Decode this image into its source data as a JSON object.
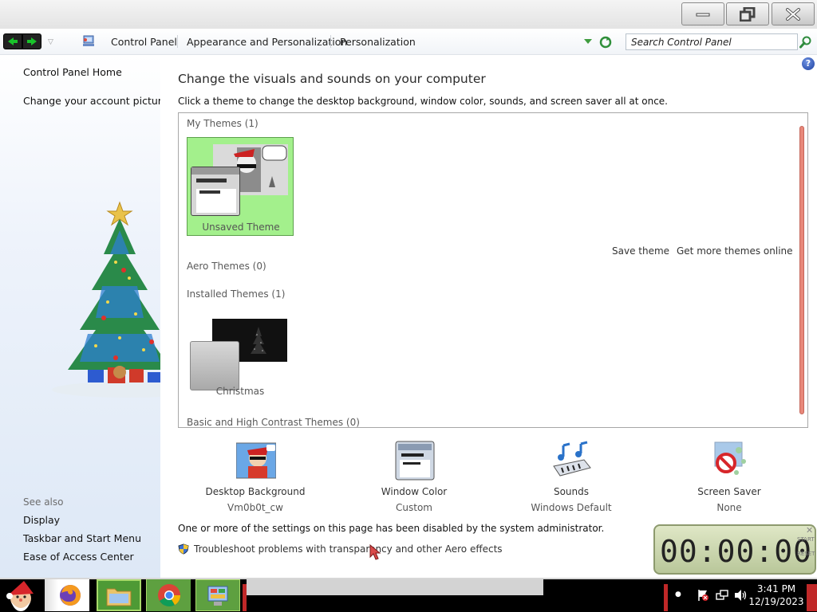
{
  "window": {
    "minimize_label": "Minimize",
    "maximize_label": "Restore",
    "close_label": "Close"
  },
  "addressbar": {
    "breadcrumbs": [
      "Control Panel",
      "Appearance and Personalization",
      "Personalization"
    ],
    "search_placeholder": "Search Control Panel"
  },
  "sidebar": {
    "links": [
      {
        "label": "Control Panel Home"
      },
      {
        "label": "Change your account picture"
      }
    ],
    "see_also_label": "See also",
    "see_also": [
      {
        "label": "Display"
      },
      {
        "label": "Taskbar and Start Menu"
      },
      {
        "label": "Ease of Access Center"
      }
    ]
  },
  "main": {
    "title": "Change the visuals and sounds on your computer",
    "subtitle": "Click a theme to change the desktop background, window color, sounds, and screen saver all at once.",
    "groups": {
      "my_themes": "My Themes (1)",
      "aero_themes": "Aero Themes (0)",
      "installed_themes": "Installed Themes (1)",
      "basic_themes": "Basic and High Contrast Themes (0)"
    },
    "themes": [
      {
        "label": "Unsaved Theme",
        "selected": true
      },
      {
        "label": "Christmas",
        "selected": false
      }
    ],
    "save_theme": "Save theme",
    "get_more_themes": "Get more themes online",
    "settings": [
      {
        "name": "Desktop Background",
        "value": "Vm0b0t_cw",
        "icon": "desktop-background-icon"
      },
      {
        "name": "Window Color",
        "value": "Custom",
        "icon": "window-color-icon"
      },
      {
        "name": "Sounds",
        "value": "Windows Default",
        "icon": "sounds-icon"
      },
      {
        "name": "Screen Saver",
        "value": "None",
        "icon": "screen-saver-icon"
      }
    ],
    "disabled_note": "One or more of the settings on this page has been disabled by the system administrator.",
    "aero_link": "Troubleshoot problems with transparency and other Aero effects"
  },
  "timer_widget": {
    "digits": "00:00:00",
    "start_label": "START",
    "reset_label": "RESET"
  },
  "taskbar": {
    "time": "3:41 PM",
    "date": "12/19/2023"
  },
  "colors": {
    "selected_tile": "#a3f08c",
    "scrollbar": "#e8887a",
    "taskbar": "#000000",
    "taskbar_active": "#5ea040"
  }
}
